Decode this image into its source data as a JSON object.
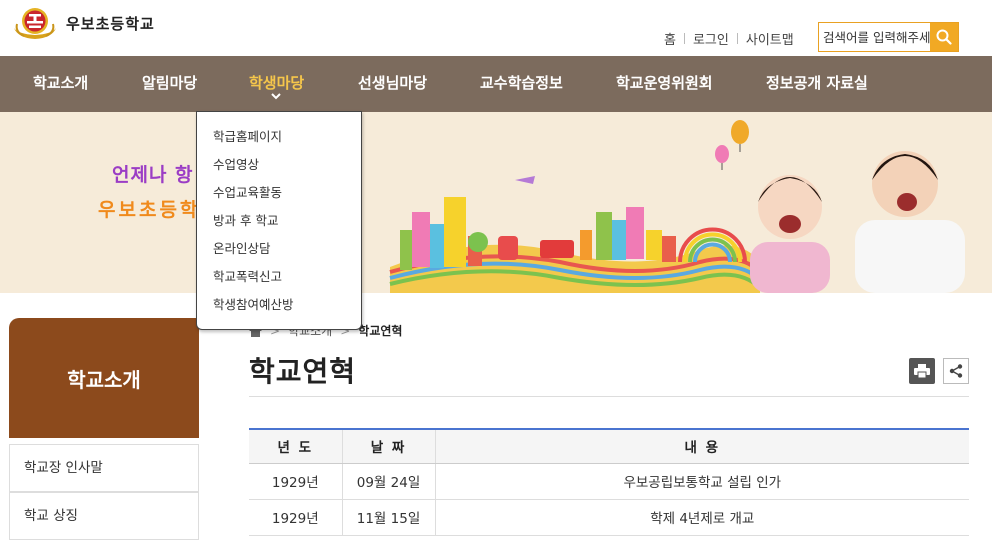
{
  "header": {
    "school_name": "우보초등학교",
    "util_links": [
      "홈",
      "로그인",
      "사이트맵"
    ],
    "search_placeholder": "검색어를 입력해주세요"
  },
  "nav": {
    "items": [
      "학교소개",
      "알림마당",
      "학생마당",
      "선생님마당",
      "교수학습정보",
      "학교운영위원회",
      "정보공개 자료실"
    ],
    "active_index": 2,
    "active_color": "#f5c64b",
    "bg_color": "#7c6b5d"
  },
  "dropdown": {
    "items": [
      "학급홈페이지",
      "수업영상",
      "수업교육활동",
      "방과 후 학교",
      "온라인상담",
      "학교폭력신고",
      "학생참여예산방"
    ]
  },
  "banner": {
    "slogan_line1": "언제나 항",
    "slogan_line2": "우보초등학"
  },
  "sidebar": {
    "title": "학교소개",
    "items": [
      "학교장 인사말",
      "학교 상징"
    ]
  },
  "breadcrumb": [
    "학교소개",
    "학교연혁"
  ],
  "page_title": "학교연혁",
  "table": {
    "headers": [
      "년 도",
      "날 짜",
      "내 용"
    ],
    "rows": [
      {
        "year": "1929년",
        "date": "09월 24일",
        "content": "우보공립보통학교 설립 인가"
      },
      {
        "year": "1929년",
        "date": "11월 15일",
        "content": "학제 4년제로 개교"
      }
    ]
  },
  "icons": [
    "search-icon",
    "home-icon",
    "print-icon",
    "share-icon",
    "school-emblem-icon"
  ]
}
